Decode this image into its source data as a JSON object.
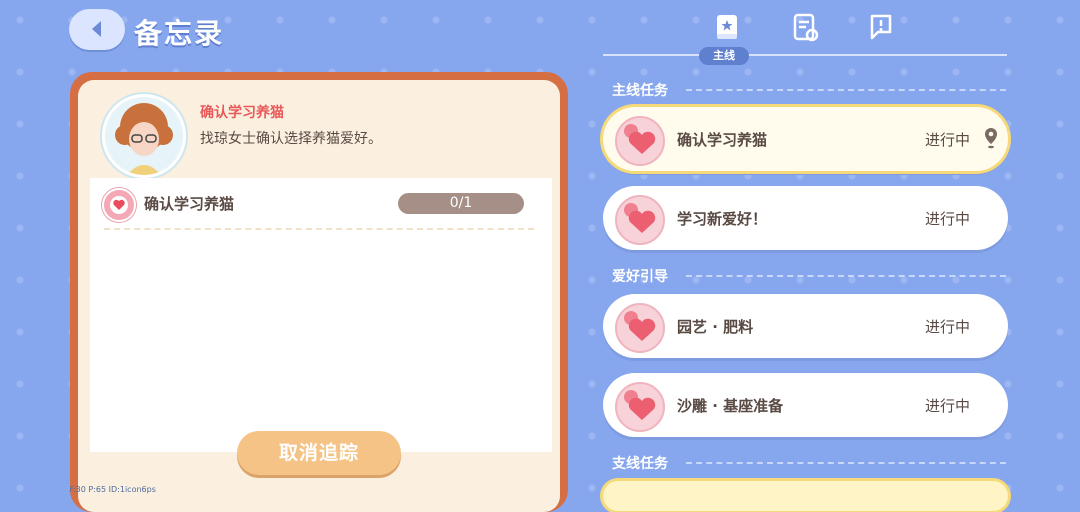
{
  "header": {
    "title": "备忘录"
  },
  "task": {
    "title": "确认学习养猫",
    "description": "找琼女士确认选择养猫爱好。",
    "objective": "确认学习养猫",
    "progress": "0/1",
    "cancel_label": "取消追踪"
  },
  "tabs": {
    "active_label": "主线"
  },
  "sections": [
    {
      "title": "主线任务",
      "items": [
        {
          "name": "确认学习养猫",
          "status": "进行中"
        },
        {
          "name": "学习新爱好！",
          "status": "进行中"
        }
      ]
    },
    {
      "title": "爱好引导",
      "items": [
        {
          "name": "园艺 · 肥料",
          "status": "进行中"
        },
        {
          "name": "沙雕 · 基座准备",
          "status": "进行中"
        }
      ]
    },
    {
      "title": "支线任务",
      "items": []
    }
  ],
  "debug": {
    "fps_text": "F:30   P:65   ID:1icon6ps"
  },
  "colors": {
    "background": "#86a6ee",
    "accent_red": "#e85a5a",
    "card_border": "#d66e44"
  }
}
